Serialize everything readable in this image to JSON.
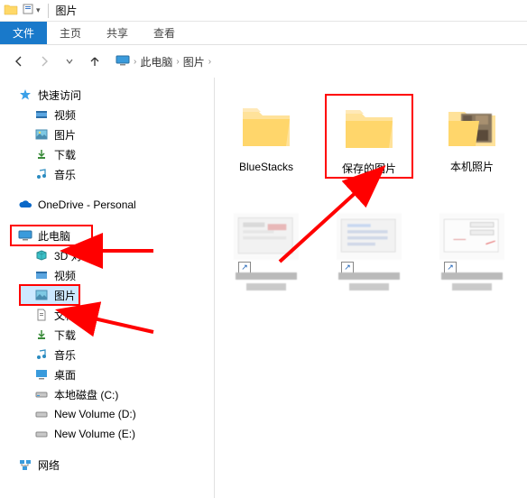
{
  "titlebar": {
    "folder_title": "图片"
  },
  "menubar": {
    "file": "文件",
    "tabs": [
      "主页",
      "共享",
      "查看"
    ]
  },
  "breadcrumbs": {
    "this_pc": "此电脑",
    "current": "图片"
  },
  "tree": {
    "quick_access": "快速访问",
    "qa_items": [
      "视频",
      "图片",
      "下载",
      "音乐"
    ],
    "onedrive": "OneDrive - Personal",
    "this_pc": "此电脑",
    "pc_items": [
      "3D 对象",
      "视频",
      "图片",
      "文档",
      "下载",
      "音乐",
      "桌面",
      "本地磁盘 (C:)",
      "New Volume (D:)",
      "New Volume (E:)"
    ],
    "network": "网络"
  },
  "items": [
    {
      "name": "BlueStacks",
      "type": "folder"
    },
    {
      "name": "保存的图片",
      "type": "folder",
      "highlighted": true
    },
    {
      "name": "本机照片",
      "type": "folder-preview"
    },
    {
      "name": "",
      "type": "shortcut-pixelated"
    },
    {
      "name": "",
      "type": "shortcut-pixelated"
    },
    {
      "name": "",
      "type": "shortcut-pixelated"
    }
  ]
}
